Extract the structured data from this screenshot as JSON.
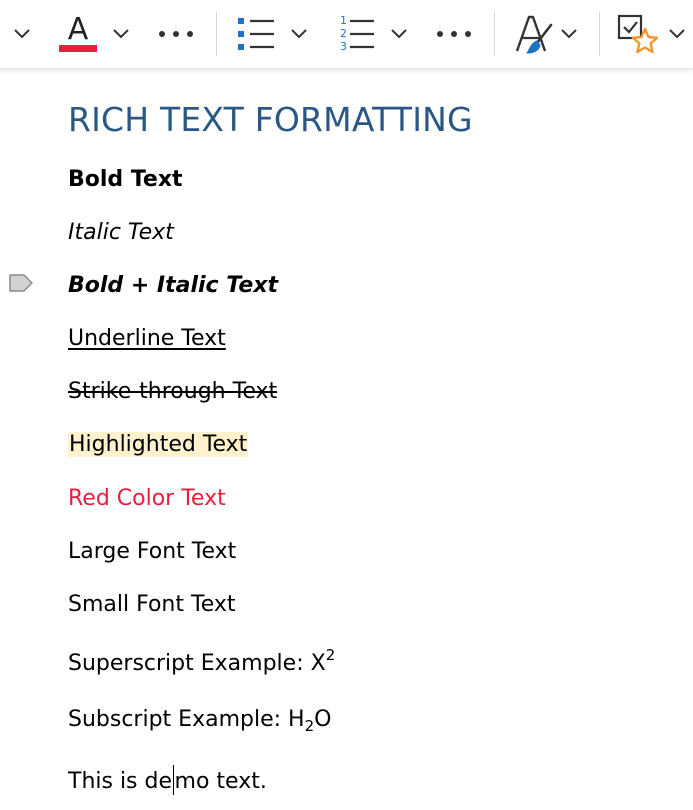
{
  "toolbar": {
    "font_color": {
      "accent": "#e81e3c",
      "letter": "A"
    },
    "numbered_list_digits": [
      "1",
      "2",
      "3"
    ],
    "icons": [
      "chevron-down-icon",
      "font-color-icon",
      "more-icon",
      "bullets-icon",
      "numbering-icon",
      "styles-icon",
      "tag-to-do-icon"
    ],
    "accent_blue": "#1e72c8",
    "star_color": "#f0962e"
  },
  "document": {
    "heading": "RICH TEXT FORMATTING",
    "heading_color": "#2a5783",
    "lines": {
      "bold": "Bold Text",
      "italic": "Italic Text",
      "bold_italic": "Bold + Italic Text",
      "underline": "Underline Text",
      "strike": "Strike-through Text",
      "highlight": "Highlighted Text",
      "red": "Red Color Text",
      "large": "Large Font Text",
      "small": "Small Font Text",
      "superscript_prefix": "Superscript Example: X",
      "superscript_value": "2",
      "subscript_prefix": "Subscript Example: H",
      "subscript_value": "2",
      "subscript_suffix": "O",
      "demo_before_caret": "This is de",
      "demo_after_caret": "mo text."
    },
    "highlight_color": "#fff2cc",
    "red_color": "#e81e3c"
  }
}
